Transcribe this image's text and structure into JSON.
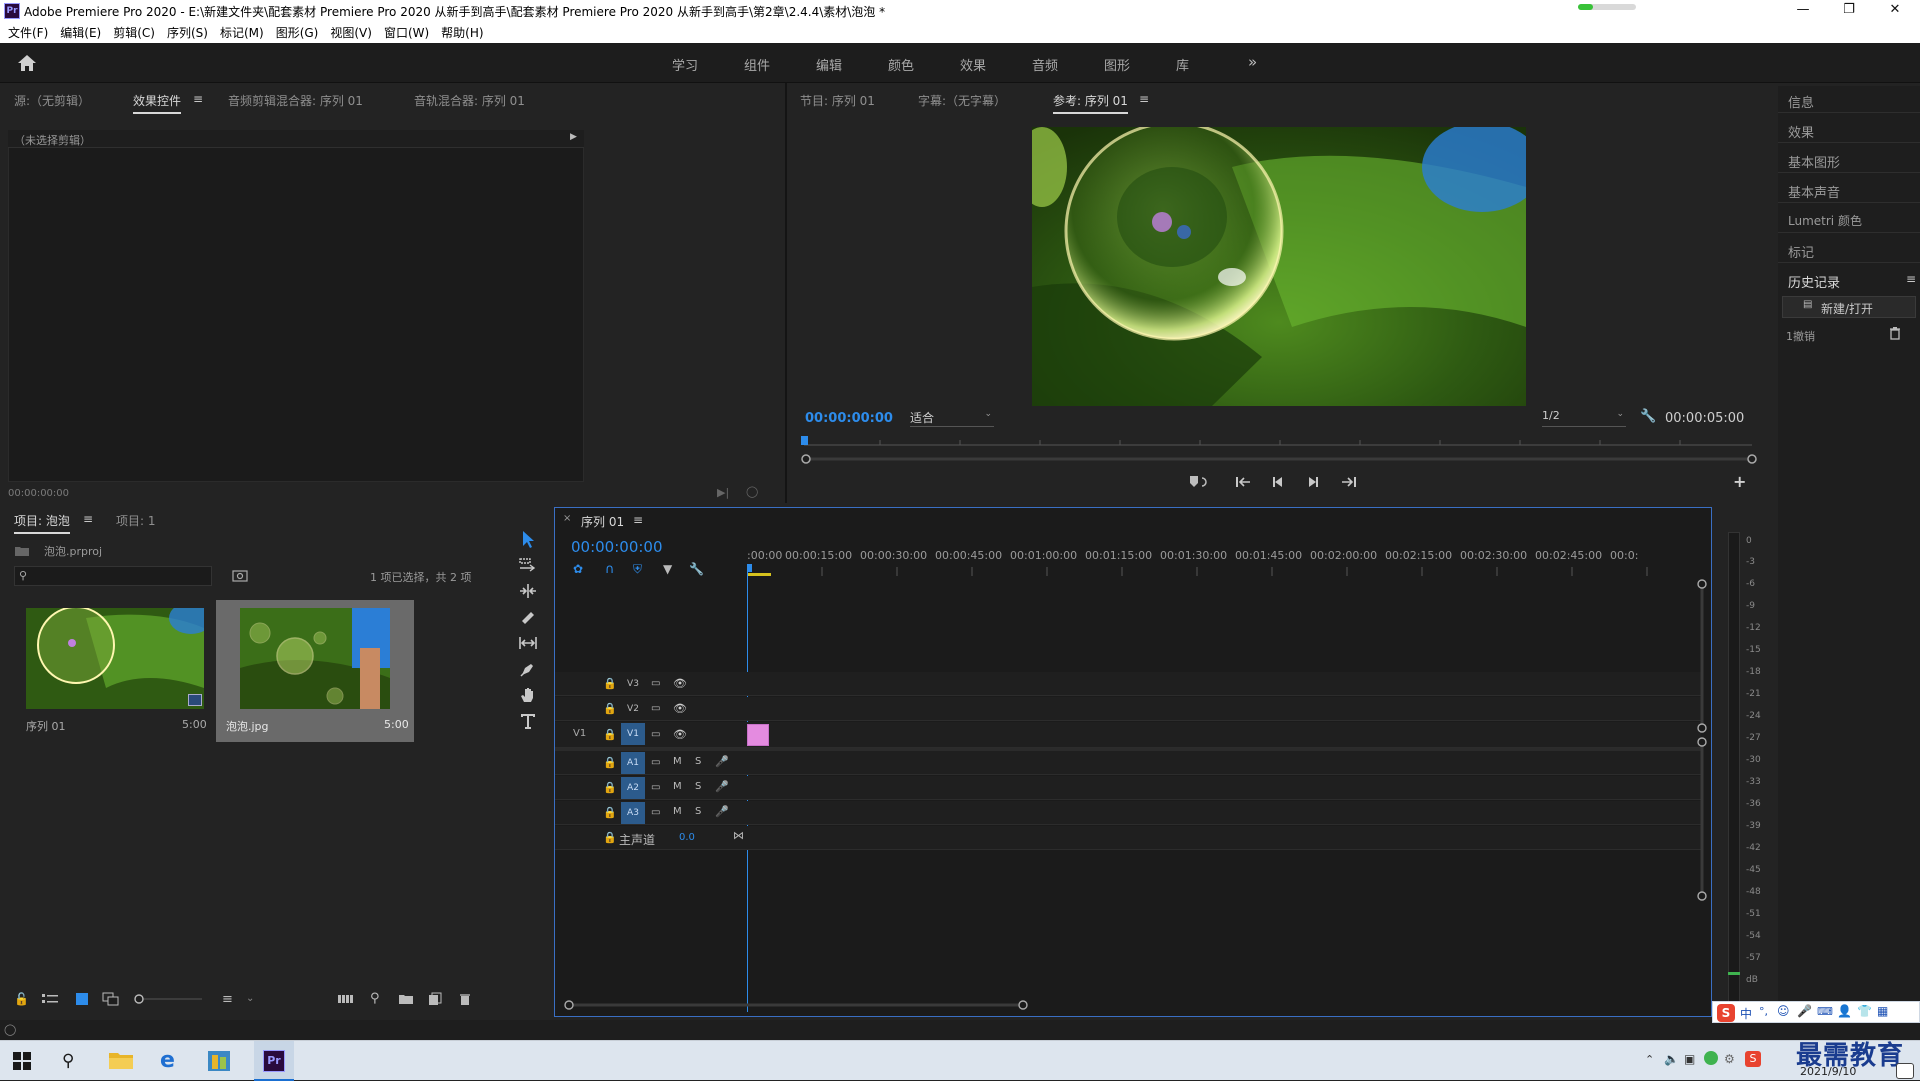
{
  "window": {
    "app_icon": "Pr",
    "title": "Adobe Premiere Pro 2020 - E:\\新建文件夹\\配套素材 Premiere Pro 2020 从新手到高手\\配套素材 Premiere Pro 2020 从新手到高手\\第2章\\2.4.4\\素材\\泡泡 *",
    "progress_fraction": 0.25,
    "controls": [
      "minimize-icon",
      "maximize-icon",
      "close-icon"
    ]
  },
  "menu": [
    "文件(F)",
    "编辑(E)",
    "剪辑(C)",
    "序列(S)",
    "标记(M)",
    "图形(G)",
    "视图(V)",
    "窗口(W)",
    "帮助(H)"
  ],
  "workspaces": [
    "学习",
    "组件",
    "编辑",
    "颜色",
    "效果",
    "音频",
    "图形",
    "库"
  ],
  "source_tabs": {
    "source": "源:（无剪辑）",
    "effect_controls": "效果控件",
    "audio_clip_mixer": "音频剪辑混合器: 序列 01",
    "audio_track_mixer": "音轨混合器: 序列 01"
  },
  "effect_controls": {
    "no_clip": "（未选择剪辑）",
    "timecode": "00:00:00:00"
  },
  "program_tabs": {
    "program": "节目: 序列 01",
    "captions": "字幕:（无字幕）",
    "reference": "参考: 序列 01"
  },
  "program": {
    "timecode": "00:00:00:00",
    "fit": "适合",
    "resolution": "1/2",
    "duration": "00:00:05:00"
  },
  "right_panel": {
    "items": [
      "信息",
      "效果",
      "基本图形",
      "基本声音",
      "Lumetri 颜色",
      "标记"
    ],
    "history_title": "历史记录",
    "history_entry": "新建/打开",
    "history_count": "1撤销"
  },
  "project": {
    "tab_project": "项目: 泡泡",
    "tab_project2": "项目: 1",
    "file": "泡泡.prproj",
    "search_placeholder": "",
    "selection": "1 项已选择，共 2 项",
    "items": [
      {
        "name": "序列 01",
        "duration": "5:00"
      },
      {
        "name": "泡泡.jpg",
        "duration": "5:00"
      }
    ]
  },
  "timeline": {
    "tab": "序列 01",
    "timecode": "00:00:00:00",
    "ruler": [
      ":00:00",
      "00:00:15:00",
      "00:00:30:00",
      "00:00:45:00",
      "00:01:00:00",
      "00:01:15:00",
      "00:01:30:00",
      "00:01:45:00",
      "00:02:00:00",
      "00:02:15:00",
      "00:02:30:00",
      "00:02:45:00",
      "00:0:"
    ],
    "video_tracks": [
      "V3",
      "V2",
      "V1"
    ],
    "source_patch": "V1",
    "audio_tracks": [
      "A1",
      "A2",
      "A3"
    ],
    "mute": "M",
    "solo": "S",
    "master": "主声道",
    "master_value": "0.0"
  },
  "meter": {
    "ticks": [
      "0",
      "-3",
      "-6",
      "-9",
      "-12",
      "-15",
      "-18",
      "-21",
      "-24",
      "-27",
      "-30",
      "-33",
      "-36",
      "-39",
      "-42",
      "-45",
      "-48",
      "-51",
      "-54",
      "-57",
      "dB"
    ]
  },
  "taskbar": {
    "watermark": "最需教育",
    "date": "2021/9/10",
    "ime": "中"
  },
  "colors": {
    "timecode_blue": "#2d8ceb",
    "track_active": "#2c5b8c",
    "clip_pink": "#e48be0",
    "panel_border": "#3a6fc4"
  }
}
